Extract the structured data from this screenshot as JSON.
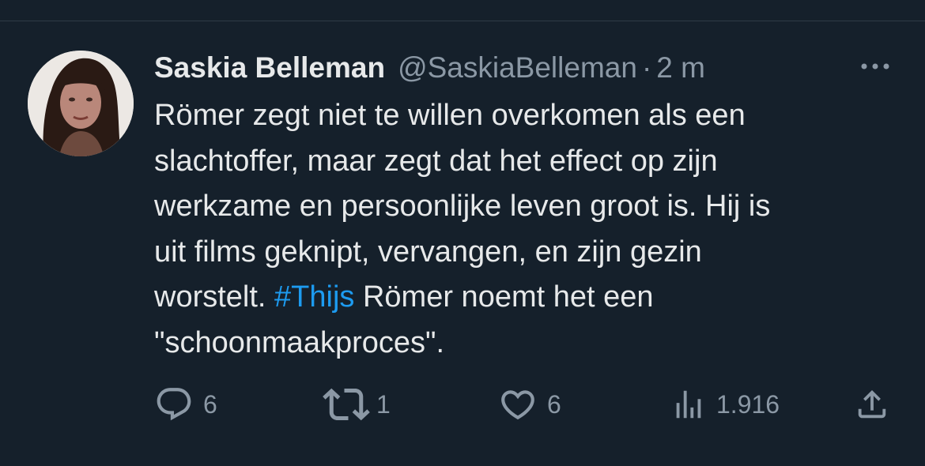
{
  "tweet": {
    "author_name": "Saskia Belleman",
    "handle": "@SaskiaBelleman",
    "separator": "·",
    "time": "2 m",
    "text_lines": [
      "Römer zegt niet te willen overkomen als een",
      "slachtoffer, maar zegt dat het effect op zijn",
      "werkzame en persoonlijke leven groot is. Hij is",
      "uit films geknipt, vervangen, en zijn gezin",
      "worstelt.",
      "#Thijs",
      "Römer noemt het een",
      "\"schoonmaakproces\"."
    ]
  },
  "actions": {
    "replies": "6",
    "retweets": "1",
    "likes": "6",
    "views": "1.916"
  },
  "icons": {
    "more": "more-horizontal-icon",
    "reply": "reply-icon",
    "retweet": "retweet-icon",
    "like": "heart-icon",
    "views": "views-chart-icon",
    "share": "share-icon"
  },
  "colors": {
    "background": "#15202b",
    "text": "#e7e9ea",
    "secondary": "#8b98a5",
    "hashtag": "#1d9bf0"
  }
}
